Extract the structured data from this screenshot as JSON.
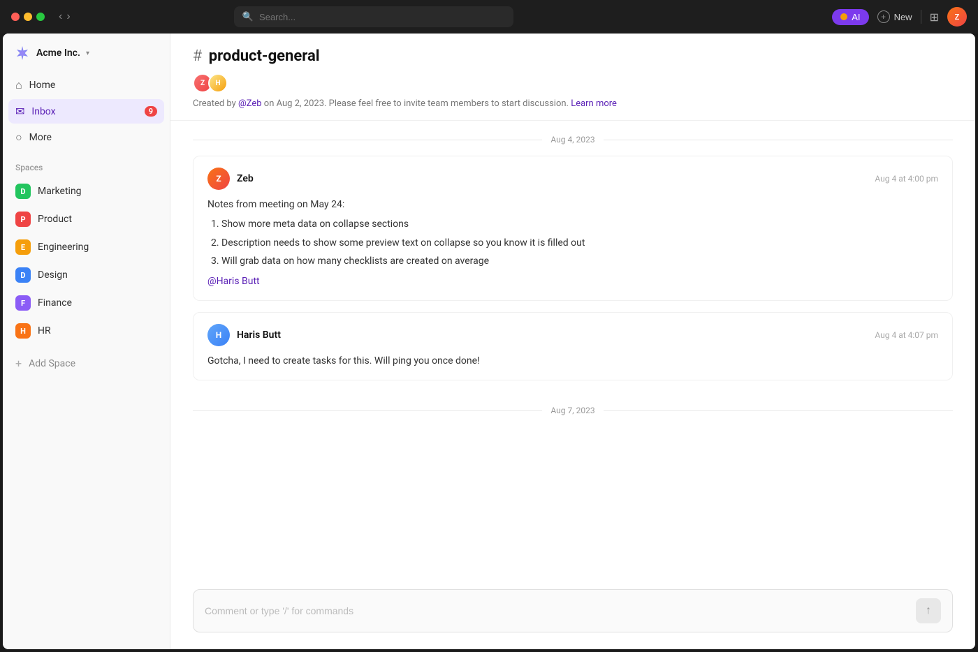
{
  "titlebar": {
    "search_placeholder": "Search...",
    "ai_label": "AI",
    "new_label": "New"
  },
  "sidebar": {
    "org_name": "Acme Inc.",
    "nav_items": [
      {
        "id": "home",
        "label": "Home",
        "icon": "🏠",
        "active": false
      },
      {
        "id": "inbox",
        "label": "Inbox",
        "icon": "✉",
        "active": true,
        "badge": "9"
      },
      {
        "id": "more",
        "label": "More",
        "icon": "○",
        "active": false
      }
    ],
    "spaces_title": "Spaces",
    "spaces": [
      {
        "id": "marketing",
        "label": "Marketing",
        "letter": "D",
        "color": "#22c55e"
      },
      {
        "id": "product",
        "label": "Product",
        "letter": "P",
        "color": "#ef4444"
      },
      {
        "id": "engineering",
        "label": "Engineering",
        "letter": "E",
        "color": "#f59e0b"
      },
      {
        "id": "design",
        "label": "Design",
        "letter": "D",
        "color": "#3b82f6"
      },
      {
        "id": "finance",
        "label": "Finance",
        "letter": "F",
        "color": "#8b5cf6"
      },
      {
        "id": "hr",
        "label": "HR",
        "letter": "H",
        "color": "#f97316"
      }
    ],
    "add_space_label": "Add Space"
  },
  "channel": {
    "name": "product-general",
    "meta": "Created by @Zeb on Aug 2, 2023. Please feel free to invite team members to start discussion.",
    "learn_more": "Learn more",
    "creator_mention": "@Zeb"
  },
  "messages": {
    "dates": [
      {
        "id": "d1",
        "label": "Aug 4, 2023"
      },
      {
        "id": "d2",
        "label": "Aug 7, 2023"
      }
    ],
    "items": [
      {
        "id": "m1",
        "sender": "Zeb",
        "time": "Aug 4 at 4:00 pm",
        "intro": "Notes from meeting on May 24:",
        "list": [
          "Show more meta data on collapse sections",
          "Description needs to show some preview text on collapse so you know it is filled out",
          "Will grab data on how many checklists are created on average"
        ],
        "mention": "@Haris Butt"
      },
      {
        "id": "m2",
        "sender": "Haris Butt",
        "time": "Aug 4 at 4:07 pm",
        "body": "Gotcha, I need to create tasks for this. Will ping you once done!"
      }
    ]
  },
  "comment_box": {
    "placeholder": "Comment or type '/' for commands"
  }
}
